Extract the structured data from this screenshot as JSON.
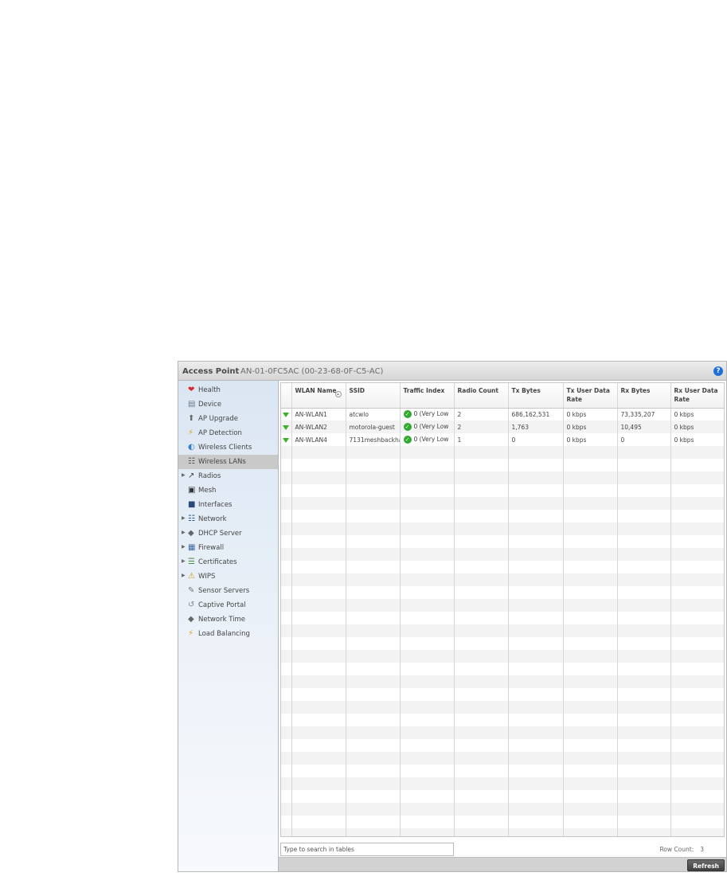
{
  "header": {
    "title": "Access Point",
    "subtitle": "AN-01-0FC5AC (00-23-68-0F-C5-AC)",
    "help_icon": "?"
  },
  "sidebar": {
    "items": [
      {
        "label": "Health",
        "icon": "health-icon",
        "expandable": false,
        "selected": false
      },
      {
        "label": "Device",
        "icon": "device-icon",
        "expandable": false,
        "selected": false
      },
      {
        "label": "AP Upgrade",
        "icon": "ap-upgrade-icon",
        "expandable": false,
        "selected": false
      },
      {
        "label": "AP Detection",
        "icon": "ap-detection-icon",
        "expandable": false,
        "selected": false
      },
      {
        "label": "Wireless Clients",
        "icon": "wireless-clients-icon",
        "expandable": false,
        "selected": false
      },
      {
        "label": "Wireless LANs",
        "icon": "wireless-lans-icon",
        "expandable": false,
        "selected": true
      },
      {
        "label": "Radios",
        "icon": "radios-icon",
        "expandable": true,
        "selected": false
      },
      {
        "label": "Mesh",
        "icon": "mesh-icon",
        "expandable": false,
        "selected": false
      },
      {
        "label": "Interfaces",
        "icon": "interfaces-icon",
        "expandable": false,
        "selected": false
      },
      {
        "label": "Network",
        "icon": "network-icon",
        "expandable": true,
        "selected": false
      },
      {
        "label": "DHCP Server",
        "icon": "dhcp-server-icon",
        "expandable": true,
        "selected": false
      },
      {
        "label": "Firewall",
        "icon": "firewall-icon",
        "expandable": true,
        "selected": false
      },
      {
        "label": "Certificates",
        "icon": "certificates-icon",
        "expandable": true,
        "selected": false
      },
      {
        "label": "WIPS",
        "icon": "wips-icon",
        "expandable": true,
        "selected": false
      },
      {
        "label": "Sensor Servers",
        "icon": "sensor-servers-icon",
        "expandable": false,
        "selected": false
      },
      {
        "label": "Captive Portal",
        "icon": "captive-portal-icon",
        "expandable": false,
        "selected": false
      },
      {
        "label": "Network Time",
        "icon": "network-time-icon",
        "expandable": false,
        "selected": false
      },
      {
        "label": "Load Balancing",
        "icon": "load-balancing-icon",
        "expandable": false,
        "selected": false
      }
    ]
  },
  "table": {
    "columns": [
      "",
      "WLAN Name",
      "SSID",
      "Traffic Index",
      "Radio Count",
      "Tx Bytes",
      "Tx User Data Rate",
      "Rx Bytes",
      "Rx User Data Rate"
    ],
    "rows": [
      [
        "AN-WLAN1",
        "atcwlo",
        "0 (Very Low",
        "2",
        "686,162,531",
        "0 kbps",
        "73,335,207",
        "0 kbps"
      ],
      [
        "AN-WLAN2",
        "motorola-guest",
        "0 (Very Low",
        "2",
        "1,763",
        "0 kbps",
        "10,495",
        "0 kbps"
      ],
      [
        "AN-WLAN4",
        "7131meshbackha",
        "0 (Very Low",
        "1",
        "0",
        "0 kbps",
        "0",
        "0 kbps"
      ]
    ],
    "status_icon": "green-down-arrow-icon",
    "traffic_icon": "check-circle-icon",
    "empty_rows": 31
  },
  "search": {
    "placeholder": "Type to search in tables"
  },
  "row_count": {
    "label": "Row Count:",
    "value": "3"
  },
  "buttons": {
    "refresh": "Refresh"
  }
}
